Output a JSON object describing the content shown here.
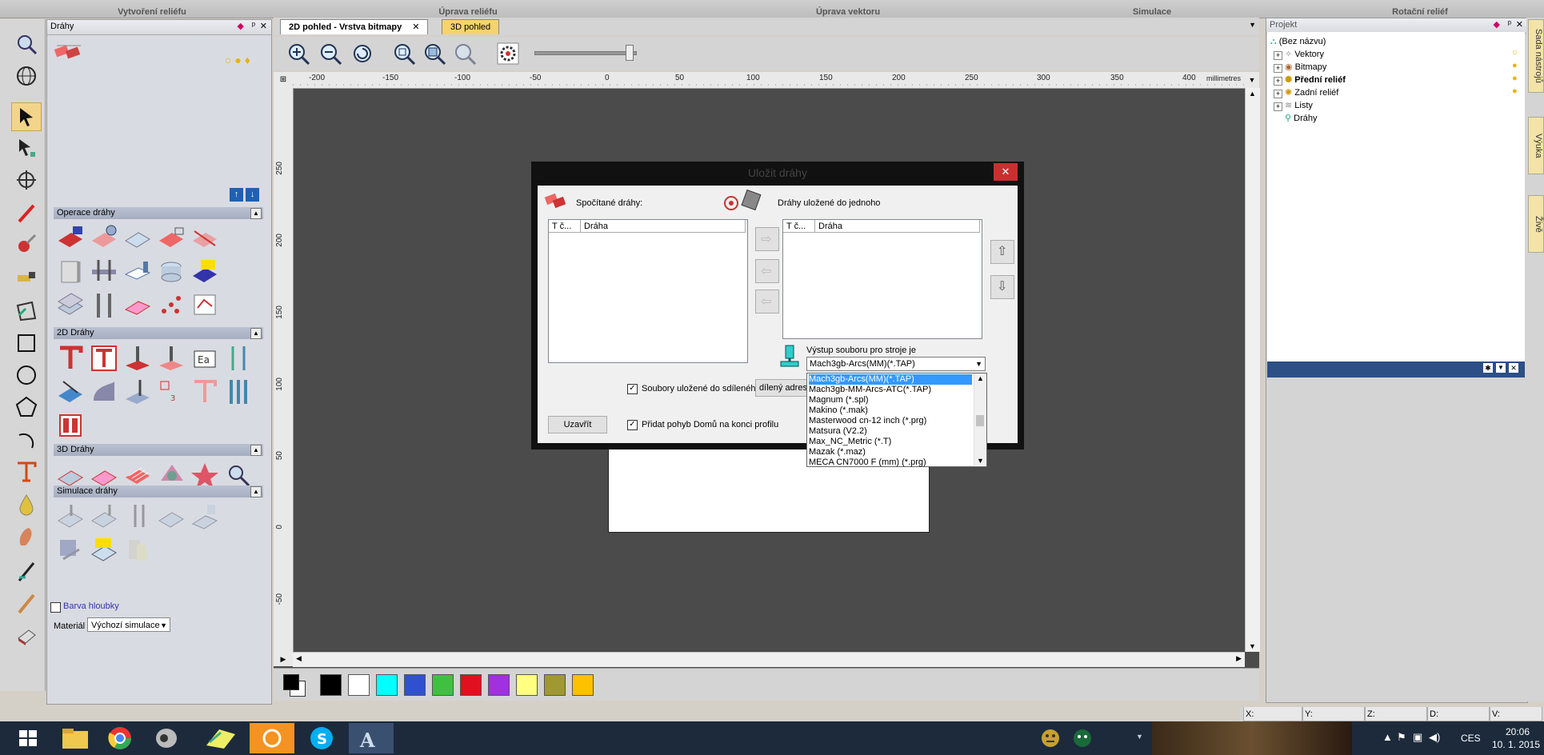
{
  "top_sections": [
    "Vytvoření reliéfu",
    "Úprava reliéfu",
    "Úprava vektoru",
    "Simulace",
    "Rotační reliéf"
  ],
  "left_panel": {
    "title": "Dráhy",
    "sections": {
      "operations": "Operace dráhy",
      "paths2d": "2D Dráhy",
      "paths3d": "3D Dráhy",
      "simulation": "Simulace dráhy"
    },
    "depth_color_label": "Barva hloubky",
    "material_label": "Materiál",
    "material_value": "Výchozí simulace"
  },
  "tabs": {
    "tab1": "2D pohled - Vrstva bitmapy",
    "tab2": "3D pohled"
  },
  "ruler": {
    "units": "millimetres",
    "h_ticks": [
      "-200",
      "-150",
      "-100",
      "-50",
      "0",
      "50",
      "100",
      "150",
      "200",
      "250",
      "300",
      "350",
      "400"
    ],
    "v_ticks": [
      "250",
      "200",
      "150",
      "100",
      "50",
      "0",
      "-50"
    ]
  },
  "palette": {
    "colors": [
      "#000000",
      "#ffffff",
      "#00ffff",
      "#3050d0",
      "#40c040",
      "#e01020",
      "#a030e0",
      "#ffff80",
      "#a09830",
      "#ffc000"
    ]
  },
  "dialog": {
    "title": "Uložit dráhy",
    "computed_label": "Spočítané dráhy:",
    "saved_label": "Dráhy uložené do jednoho",
    "col_tool": "T č...",
    "col_path": "Dráha",
    "output_label": "Výstup souboru pro stroje je",
    "selected_format": "Mach3gb-Arcs(MM)(*.TAP)",
    "shared_folder_check": "Soubory uložené do sdílenéh",
    "shared_address_button": "dílený adres",
    "home_move_check": "Přidat pohyb Domů na konci profilu",
    "close_button": "Uzavřít",
    "close_x": "✕",
    "formats": [
      "Mach3gb-Arcs(MM)(*.TAP)",
      "Mach3gb-MM-Arcs-ATC(*.TAP)",
      "Magnum (*.spl)",
      "Makino (*.mak)",
      "Masterwood cn-12 inch (*.prg)",
      "Matsura (V2.2)",
      "Max_NC_Metric (*.T)",
      "Mazak (*.maz)",
      "MECA CN7000 F (mm) (*.prg)"
    ]
  },
  "project": {
    "title": "Projekt",
    "root": "(Bez názvu)",
    "items": [
      "Vektory",
      "Bitmapy",
      "Přední reliéf",
      "Zadní reliéf",
      "Listy",
      "Dráhy"
    ]
  },
  "side_tabs": [
    "Sada nástrojů",
    "Výuka",
    "Živě"
  ],
  "status": {
    "x": "X:",
    "y": "Y:",
    "z": "Z:",
    "d": "D:",
    "v": "V:"
  },
  "taskbar": {
    "lang": "CES",
    "time": "20:06",
    "date": "10. 1. 2015"
  }
}
